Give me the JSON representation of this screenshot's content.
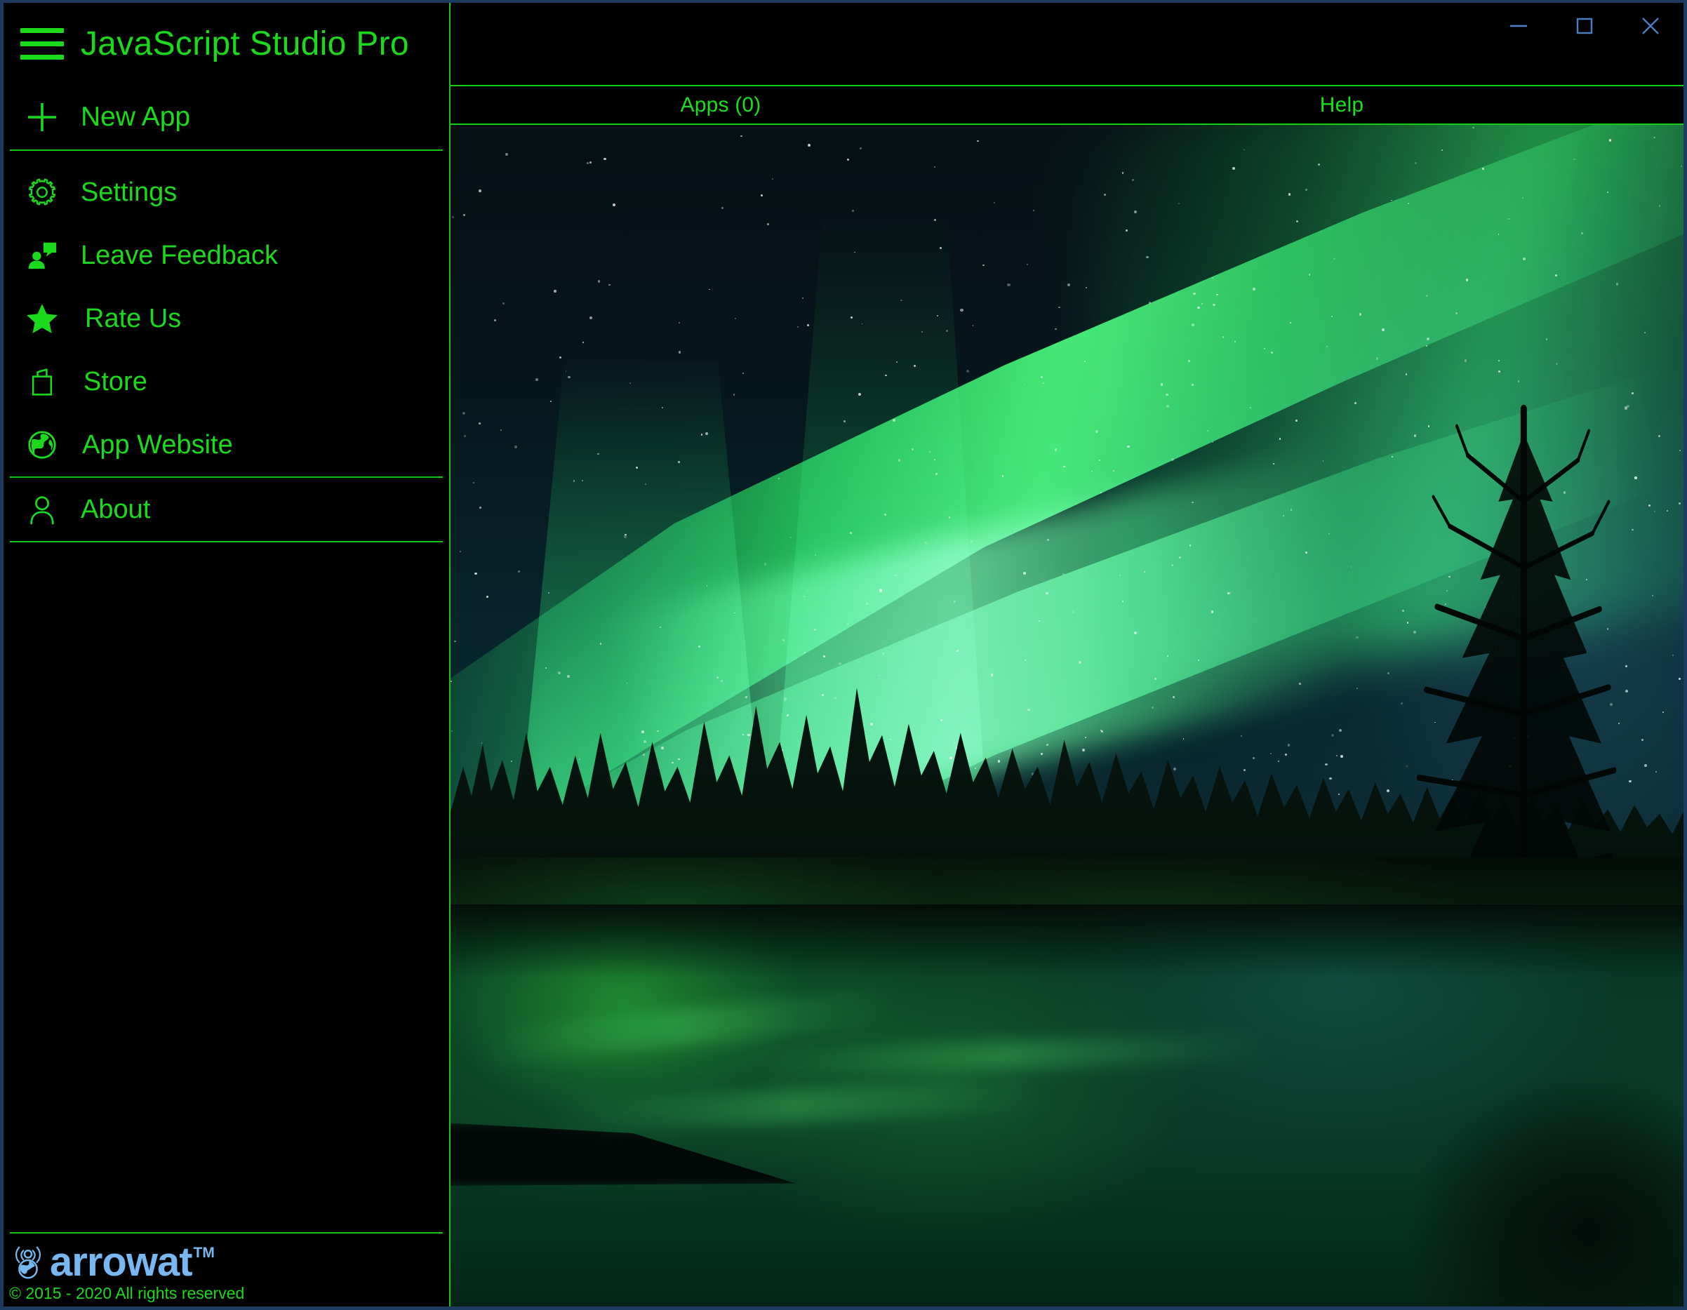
{
  "window": {
    "title": "JavaScript Studio Pro",
    "controls": [
      {
        "name": "minimize",
        "label": "—"
      },
      {
        "name": "maximize",
        "label": "□"
      },
      {
        "name": "close",
        "label": "✕"
      }
    ],
    "border_color": "#1f3a5f",
    "control_color": "#4a7fc1"
  },
  "theme": {
    "accent_green": "#1bd91b",
    "line_green": "#17c417",
    "brand_blue": "#76b8ef",
    "background": "#000000"
  },
  "sidebar": {
    "menu_icon": "hamburger-icon",
    "title": "JavaScript Studio Pro",
    "primary": {
      "icon": "plus-icon",
      "label": "New App"
    },
    "items": [
      {
        "icon": "gear-icon",
        "label": "Settings"
      },
      {
        "icon": "feedback-icon",
        "label": "Leave Feedback"
      },
      {
        "icon": "star-icon",
        "label": "Rate Us"
      },
      {
        "icon": "bag-icon",
        "label": "Store"
      },
      {
        "icon": "globe-icon",
        "label": "App Website"
      }
    ],
    "about": {
      "icon": "person-icon",
      "label": "About"
    },
    "footer": {
      "logo_icon": "arrowat-globe-signal-icon",
      "brand": "arrowat",
      "trademark": "TM",
      "copyright": "© 2015 - 2020 All rights reserved"
    }
  },
  "tabs": [
    {
      "name": "apps",
      "label": "Apps (0)",
      "selected": false
    },
    {
      "name": "help",
      "label": "Help",
      "selected": false
    }
  ],
  "content": {
    "background_image": "aurora-borealis-night-landscape",
    "description": "Aurora borealis over a forest and frozen lake at night"
  }
}
